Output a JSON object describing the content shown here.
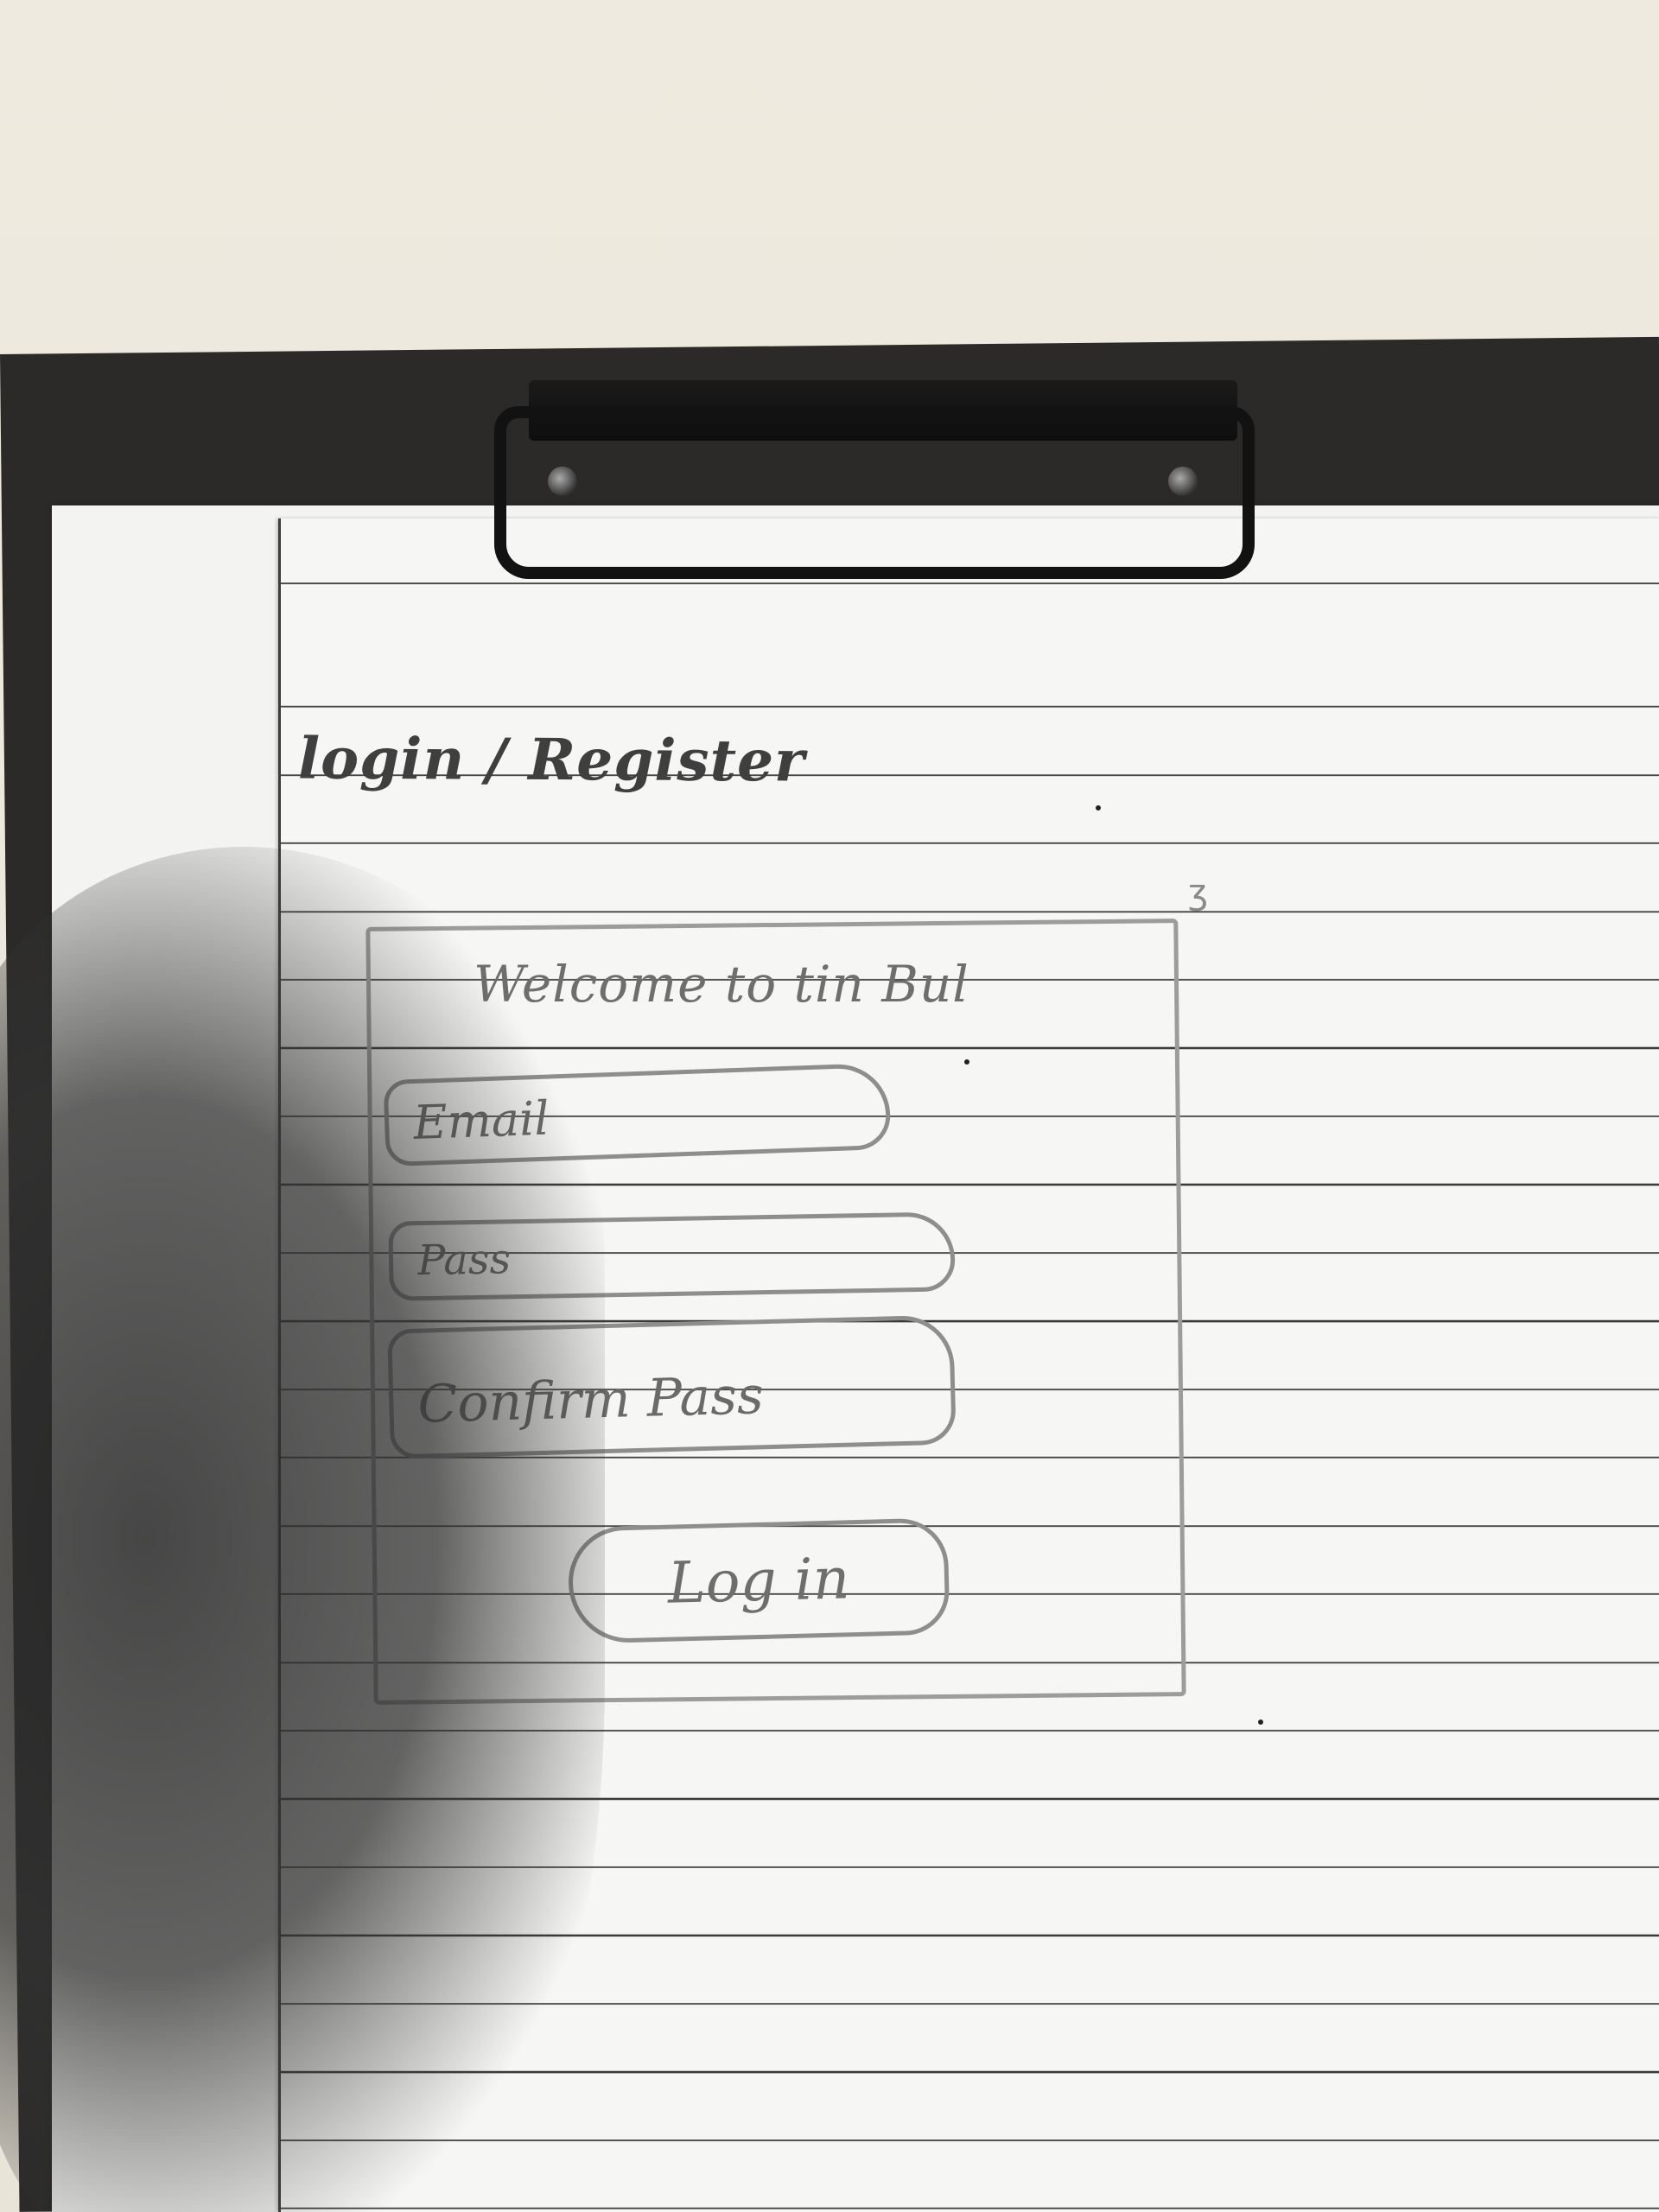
{
  "sketch": {
    "page_title": "login / Register",
    "welcome_heading": "Welcome to tin Bul",
    "email_placeholder": "Email",
    "password_placeholder": "Pass",
    "confirm_password_placeholder": "Confirm Pass",
    "login_button_label": "Log in"
  },
  "colors": {
    "paper": "#f6f6f4",
    "pencil": "#8e8e8e",
    "ink": "#3f3f3f",
    "clipboard": "#2b2a29"
  }
}
